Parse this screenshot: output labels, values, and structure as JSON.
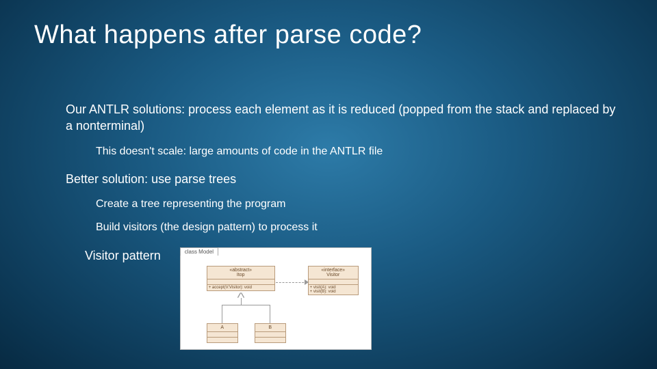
{
  "title": "What happens after parse code?",
  "bullets": {
    "b1": "Our ANTLR solutions: process each element as it is reduced (popped from the stack and replaced by a nonterminal)",
    "b1_1": "This doesn't scale: large amounts of code in the ANTLR file",
    "b2": "Better solution: use parse trees",
    "b2_1": "Create a tree representing the program",
    "b2_2": "Build visitors (the design pattern) to process it",
    "b3": "Visitor pattern"
  },
  "uml": {
    "tab": "class Model",
    "top_stereo": "«abstract»",
    "top_name": "Itop",
    "top_op": "+ accept(V:Visitor): void",
    "visitor_stereo": "«interface»",
    "visitor_name": "Visitor",
    "visitor_op1": "+ visit(A): void",
    "visitor_op2": "+ visit(B): void",
    "a_name": "A",
    "b_name": "B"
  }
}
